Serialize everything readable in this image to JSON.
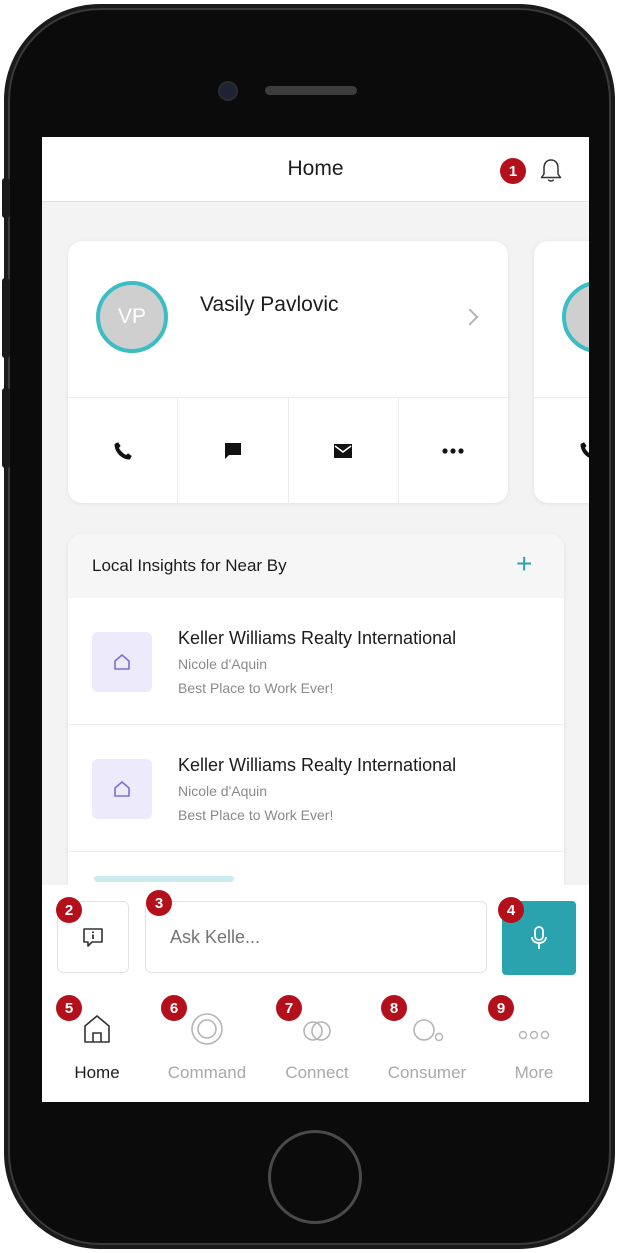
{
  "header": {
    "title": "Home"
  },
  "contact_card": {
    "initials": "VP",
    "name": "Vasily Pavlovic",
    "actions": [
      "phone-icon",
      "message-icon",
      "mail-icon",
      "more-icon"
    ]
  },
  "insights": {
    "title": "Local Insights for Near By",
    "add_label": "+",
    "items": [
      {
        "name": "Keller Williams Realty International",
        "person": "Nicole d'Aquin",
        "tagline": "Best Place to Work Ever!"
      },
      {
        "name": "Keller Williams Realty International",
        "person": "Nicole d'Aquin",
        "tagline": "Best Place to Work Ever!"
      }
    ]
  },
  "ask": {
    "placeholder": "Ask Kelle..."
  },
  "tabs": [
    {
      "label": "Home",
      "icon": "home-icon",
      "active": true
    },
    {
      "label": "Command",
      "icon": "command-icon",
      "active": false
    },
    {
      "label": "Connect",
      "icon": "connect-icon",
      "active": false
    },
    {
      "label": "Consumer",
      "icon": "consumer-icon",
      "active": false
    },
    {
      "label": "More",
      "icon": "more-icon",
      "active": false
    }
  ],
  "annotations": [
    "1",
    "2",
    "3",
    "4",
    "5",
    "6",
    "7",
    "8",
    "9"
  ],
  "colors": {
    "accent": "#2aa3ae",
    "badge": "#b3101c",
    "avatar_ring": "#3bbdc4",
    "icon_bg": "#eceafb"
  }
}
